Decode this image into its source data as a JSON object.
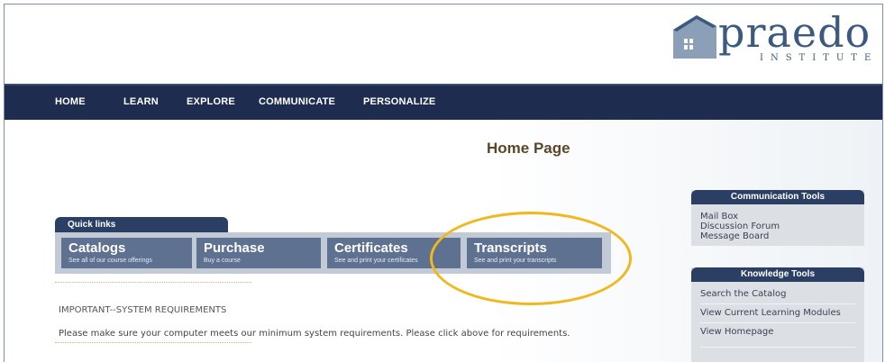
{
  "logo": {
    "name": "praedo",
    "sub": "INSTITUTE"
  },
  "nav": {
    "items": [
      "HOME",
      "LEARN",
      "EXPLORE",
      "COMMUNICATE",
      "PERSONALIZE"
    ]
  },
  "page_title": "Home Page",
  "quick_links": {
    "tab_label": "Quick links",
    "buttons": [
      {
        "title": "Catalogs",
        "subtitle": "See all of our course offerings"
      },
      {
        "title": "Purchase",
        "subtitle": "Buy a course"
      },
      {
        "title": "Certificates",
        "subtitle": "See and print your certificates"
      },
      {
        "title": "Transcripts",
        "subtitle": "See and print your transcripts"
      }
    ]
  },
  "requirements": {
    "heading": "IMPORTANT--SYSTEM REQUIREMENTS",
    "text": "Please make sure your computer meets our minimum system requirements. Please click above for requirements."
  },
  "communication_tools": {
    "title": "Communication Tools",
    "links": [
      "Mail Box",
      "Discussion Forum",
      "Message Board"
    ]
  },
  "knowledge_tools": {
    "title": "Knowledge Tools",
    "links": [
      "Search the Catalog",
      "View Current Learning Modules",
      "View Homepage"
    ]
  },
  "colors": {
    "navy": "#1d2c4f",
    "button": "#5f7191",
    "highlight_circle": "#f2b71c",
    "title_brown": "#5b4628"
  },
  "icons": [
    "house-logo-icon"
  ]
}
